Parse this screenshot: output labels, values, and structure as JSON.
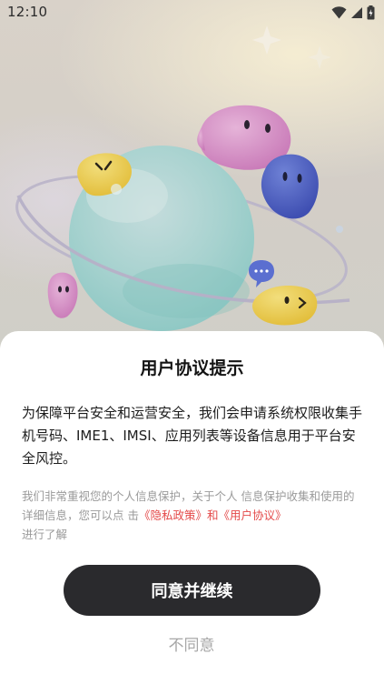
{
  "status_bar": {
    "time": "12:10"
  },
  "dialog": {
    "title": "用户协议提示",
    "main_text": "为保障平台安全和运营安全，我们会申请系统权限收集手机号码、IME1、IMSI、应用列表等设备信息用于平台安全风控。",
    "desc_prefix": "我们非常重视您的个人信息保护，关于个人 信息保护收集和使用的详细信息，您可以点 击",
    "privacy_link": "《隐私政策》",
    "and_text": "和",
    "user_agreement_link": "《用户协议》",
    "desc_suffix": "进行了解",
    "agree_label": "同意并继续",
    "disagree_label": "不同意"
  },
  "colors": {
    "link": "#e44a4a",
    "button_bg": "#2a2a2d"
  }
}
